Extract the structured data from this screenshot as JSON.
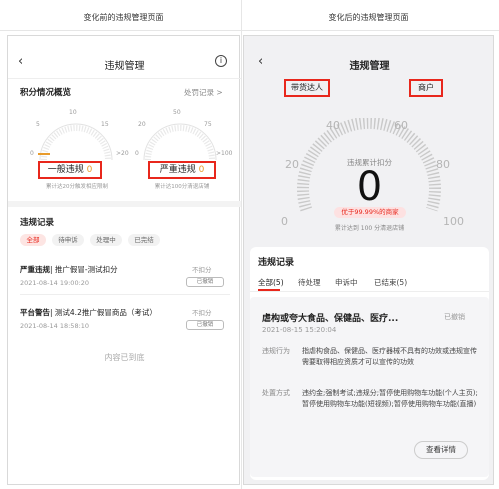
{
  "captions": {
    "before": "变化前的违规管理页面",
    "after": "变化后的违规管理页面"
  },
  "left": {
    "title": "违规管理",
    "back_icon": "‹",
    "info_icon": "i",
    "overview": {
      "title": "积分情况概览",
      "link": "处罚记录 >"
    },
    "gauge_general": {
      "ticks": [
        "5",
        "10",
        "15",
        "0",
        ">20"
      ],
      "label": "一般违规",
      "value": "0",
      "note": "累计达20分触发相应限制",
      "accent": "#e89b2b"
    },
    "gauge_serious": {
      "ticks": [
        "20",
        "50",
        "75",
        "0",
        ">100"
      ],
      "label": "严重违规",
      "value": "0",
      "note": "累计达100分清退店铺"
    },
    "records": {
      "title": "违规记录",
      "chips": [
        "全部",
        "待申诉",
        "处理中",
        "已完结"
      ],
      "items": [
        {
          "type": "严重违规",
          "desc": "| 推广假冒-测试扣分",
          "time": "2021-08-14 19:00:20",
          "status": "不扣分",
          "btn": "已撤销"
        },
        {
          "type": "平台警告",
          "desc": "| 测试4.2推广假冒商品（考试）",
          "time": "2021-08-14 18:58:10",
          "status": "不扣分",
          "btn": "已撤销"
        }
      ],
      "end_text": "内容已到底"
    }
  },
  "right": {
    "title": "违规管理",
    "back_icon": "‹",
    "tabs": [
      "带货达人",
      "商户"
    ],
    "gauge": {
      "ticks": [
        "0",
        "20",
        "40",
        "60",
        "80",
        "100"
      ],
      "label": "违规累计扣分",
      "value": "0",
      "badge": "优于99.99%的商家",
      "note": "累计达到 100 分清退店铺"
    },
    "records": {
      "title": "违规记录",
      "tabs": [
        "全部(5)",
        "待处理",
        "申诉中",
        "已结束(5)"
      ],
      "item": {
        "title": "虐构或夸大食品、保健品、医疗...",
        "status": "已撤销",
        "time": "2021-08-15 15:20:04",
        "behavior_label": "违规行为",
        "behavior": "指虐构食品、保健品、医疗器械不具有的功效或违规宣传需要取得相应资质才可以宣传的功效",
        "method_label": "处置方式",
        "method": "违约金;强制考试;违规分;暂停使用购物车功能(个人主页);暂停使用购物车功能(短视频);暂停使用购物车功能(直播)",
        "detail_btn": "查看详情"
      }
    }
  },
  "colors": {
    "red": "#e8271c",
    "orange": "#e89b2b",
    "badge_bg": "#fde1e1"
  }
}
